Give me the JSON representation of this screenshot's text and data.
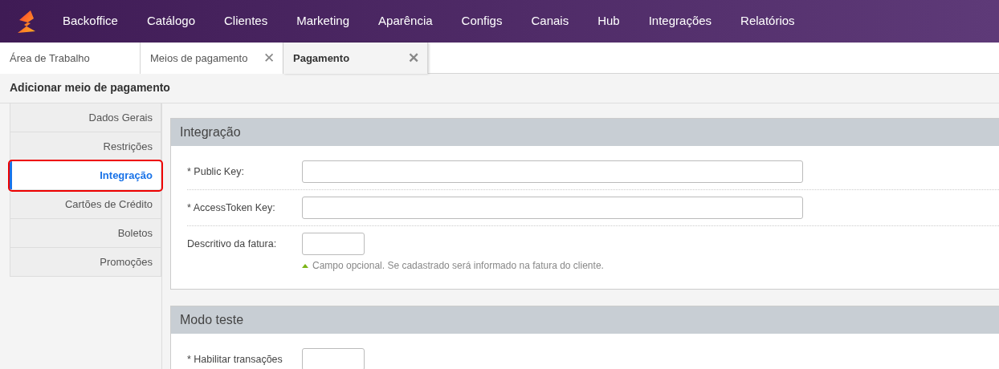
{
  "navbar": {
    "items": [
      "Backoffice",
      "Catálogo",
      "Clientes",
      "Marketing",
      "Aparência",
      "Configs",
      "Canais",
      "Hub",
      "Integrações",
      "Relatórios"
    ]
  },
  "tabs": [
    {
      "label": "Área de Trabalho",
      "selected": false
    },
    {
      "label": "Meios de pagamento",
      "selected": false,
      "close": "✕"
    },
    {
      "label": "Pagamento",
      "selected": true,
      "close": "✕"
    }
  ],
  "page_title": "Adicionar meio de pagamento",
  "sidebar": {
    "items": [
      {
        "label": "Dados Gerais",
        "selected": false
      },
      {
        "label": "Restrições",
        "selected": false
      },
      {
        "label": "Integração",
        "selected": true
      },
      {
        "label": "Cartões de Crédito",
        "selected": false
      },
      {
        "label": "Boletos",
        "selected": false
      },
      {
        "label": "Promoções",
        "selected": false
      }
    ]
  },
  "sections": [
    {
      "title": "Integração",
      "fields": [
        {
          "label": "* Public Key:",
          "kind": "wide"
        },
        {
          "label": "* AccessToken Key:",
          "kind": "wide"
        },
        {
          "label": "Descritivo da fatura:",
          "kind": "short",
          "hint": "Campo opcional. Se cadastrado será informado na fatura do cliente."
        }
      ]
    },
    {
      "title": "Modo teste",
      "fields": [
        {
          "label": "* Habilitar transações",
          "kind": "short"
        }
      ]
    }
  ]
}
